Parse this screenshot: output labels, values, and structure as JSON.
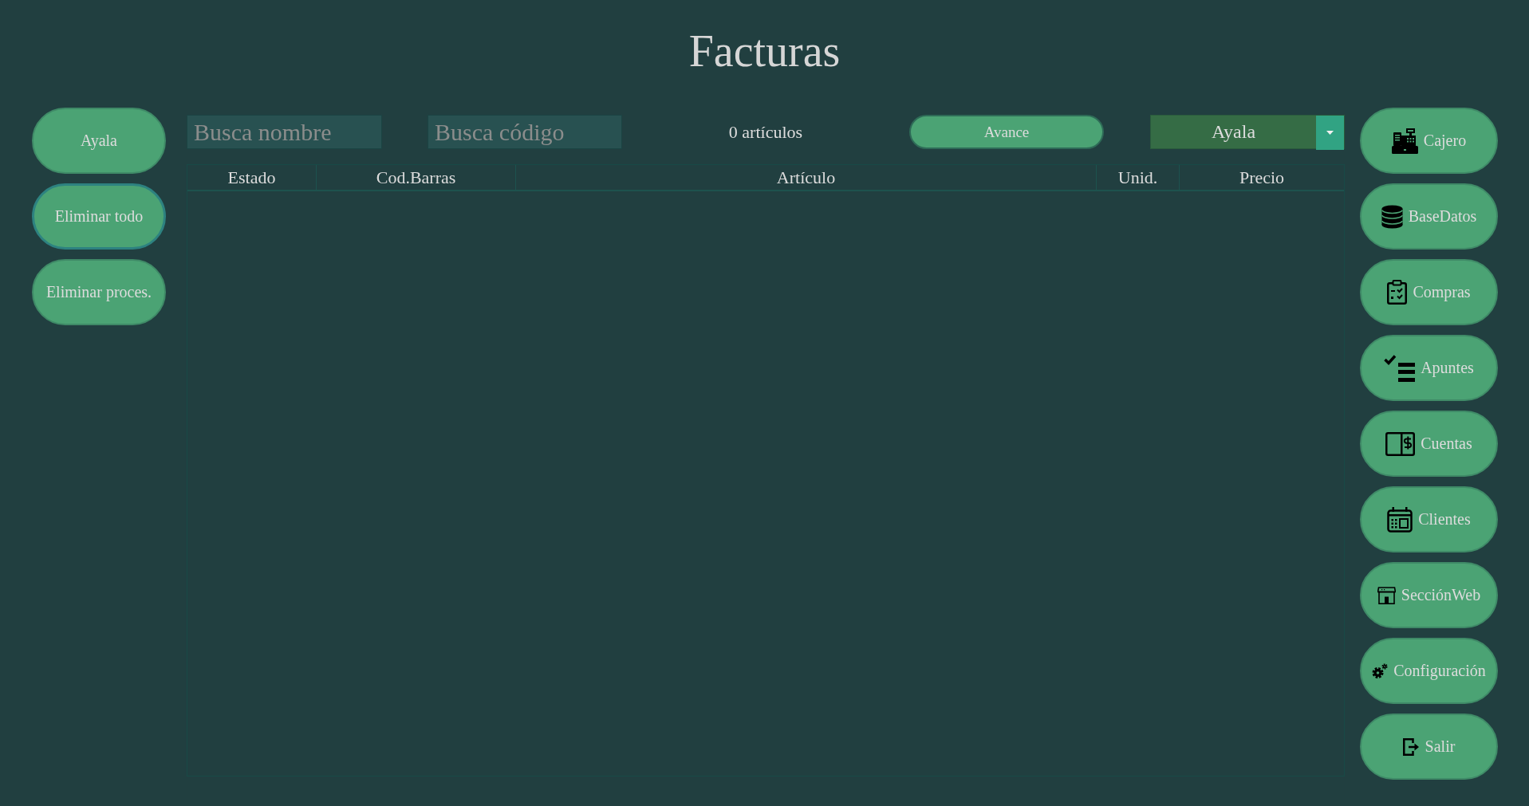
{
  "window": {
    "title": "Facturas"
  },
  "left_buttons": [
    {
      "label": "Ayala",
      "focused": false
    },
    {
      "label": "Eliminar todo",
      "focused": true
    },
    {
      "label": "Eliminar proces.",
      "focused": false
    }
  ],
  "toolbar": {
    "name_search": {
      "placeholder": "Busca nombre"
    },
    "code_search": {
      "placeholder": "Busca código"
    },
    "item_count": "0 artículos",
    "advance_button": "Avance",
    "user_select": {
      "value": "Ayala"
    }
  },
  "table": {
    "columns": [
      "Estado",
      "Cod.Barras",
      "Artículo",
      "Unid.",
      "Precio"
    ]
  },
  "nav_buttons": [
    "Cajero",
    "BaseDatos",
    "Compras",
    "Apuntes",
    "Cuentas",
    "Clientes",
    "SecciónWeb",
    "Configuración",
    "Salir"
  ]
}
